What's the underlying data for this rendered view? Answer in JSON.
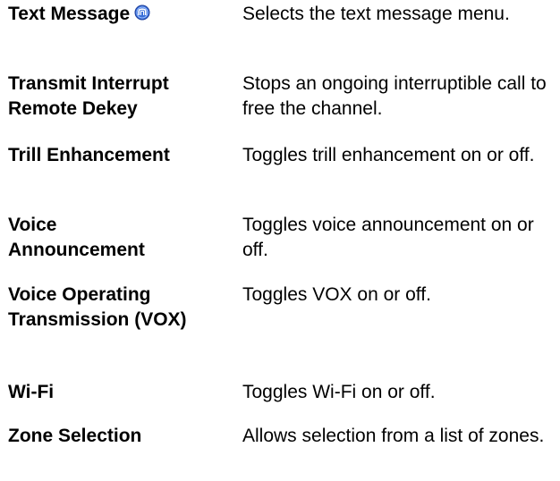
{
  "rows": [
    {
      "term": "Text Message",
      "description": "Selects the text message menu.",
      "icon": "premium-feature-icon"
    },
    {
      "term": "Transmit Interrupt Remote Dekey",
      "description": "Stops an ongoing interruptible call to free the channel."
    },
    {
      "term": "Trill Enhancement",
      "description": "Toggles trill enhancement on or off."
    },
    {
      "term": "Voice Announcement",
      "description": "Toggles voice announcement on or off."
    },
    {
      "term": "Voice Operating Transmission (VOX)",
      "description": "Toggles VOX on or off."
    },
    {
      "term": "Wi-Fi",
      "description": "Toggles Wi-Fi on or off."
    },
    {
      "term": "Zone Selection",
      "description": "Allows selection from a list of zones."
    }
  ],
  "colors": {
    "icon_fill": "#3a6fd8",
    "icon_stroke": "#1f3f9a"
  }
}
